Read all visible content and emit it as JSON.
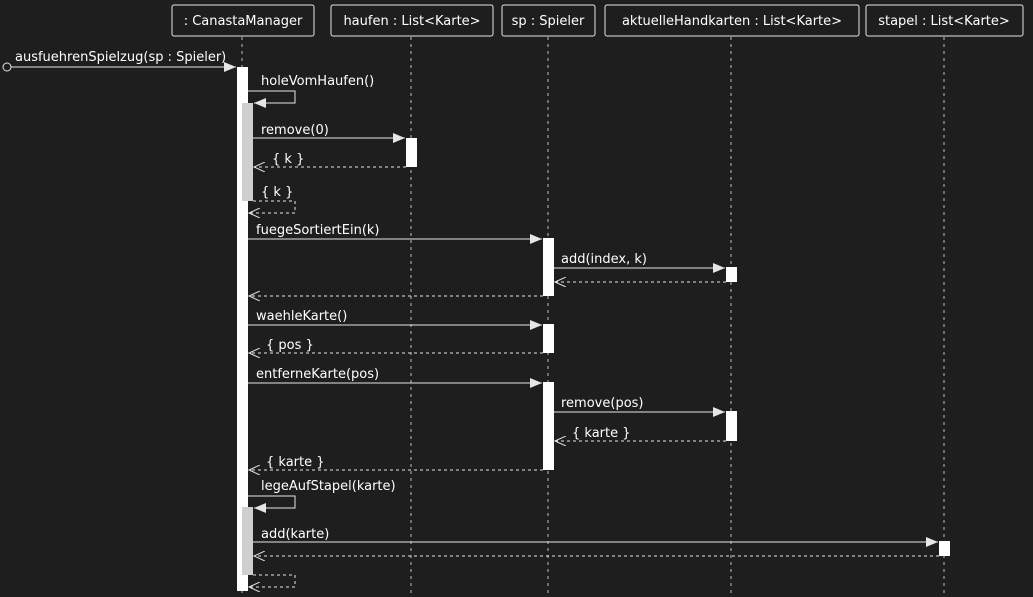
{
  "participants": [
    {
      "id": "cm",
      "label": ": CanastaManager"
    },
    {
      "id": "haufen",
      "label": "haufen : List<Karte>"
    },
    {
      "id": "sp",
      "label": "sp : Spieler"
    },
    {
      "id": "hand",
      "label": "aktuelleHandkarten : List<Karte>"
    },
    {
      "id": "stapel",
      "label": "stapel : List<Karte>"
    }
  ],
  "messages": [
    {
      "from": "found",
      "to": "cm",
      "label": "ausfuehrenSpielzug(sp : Spieler)",
      "kind": "call"
    },
    {
      "from": "cm",
      "to": "cm",
      "label": "holeVomHaufen()",
      "kind": "self-call"
    },
    {
      "from": "cm",
      "to": "haufen",
      "label": "remove(0)",
      "kind": "call"
    },
    {
      "from": "haufen",
      "to": "cm",
      "label": "{ k }",
      "kind": "return"
    },
    {
      "from": "cm",
      "to": "cm",
      "label": "{ k }",
      "kind": "self-return"
    },
    {
      "from": "cm",
      "to": "sp",
      "label": "fuegeSortiertEin(k)",
      "kind": "call"
    },
    {
      "from": "sp",
      "to": "hand",
      "label": "add(index, k)",
      "kind": "call"
    },
    {
      "from": "hand",
      "to": "sp",
      "label": "",
      "kind": "return"
    },
    {
      "from": "sp",
      "to": "cm",
      "label": "",
      "kind": "return"
    },
    {
      "from": "cm",
      "to": "sp",
      "label": "waehleKarte()",
      "kind": "call"
    },
    {
      "from": "sp",
      "to": "cm",
      "label": "{ pos }",
      "kind": "return"
    },
    {
      "from": "cm",
      "to": "sp",
      "label": "entferneKarte(pos)",
      "kind": "call"
    },
    {
      "from": "sp",
      "to": "hand",
      "label": "remove(pos)",
      "kind": "call"
    },
    {
      "from": "hand",
      "to": "sp",
      "label": "{ karte }",
      "kind": "return"
    },
    {
      "from": "sp",
      "to": "cm",
      "label": "{ karte }",
      "kind": "return"
    },
    {
      "from": "cm",
      "to": "cm",
      "label": "legeAufStapel(karte)",
      "kind": "self-call"
    },
    {
      "from": "cm",
      "to": "stapel",
      "label": "add(karte)",
      "kind": "call"
    },
    {
      "from": "stapel",
      "to": "cm",
      "label": "",
      "kind": "return"
    },
    {
      "from": "cm",
      "to": "cm",
      "label": "",
      "kind": "self-return"
    }
  ],
  "colors": {
    "background": "#1e1e1e",
    "line": "#e6e6e6",
    "lifeline": "#bdbdbd",
    "participant_box": "#1e1e1e",
    "activation": "#ffffff",
    "nested_activation": "#cfcfcf",
    "text": "#ffffff"
  }
}
